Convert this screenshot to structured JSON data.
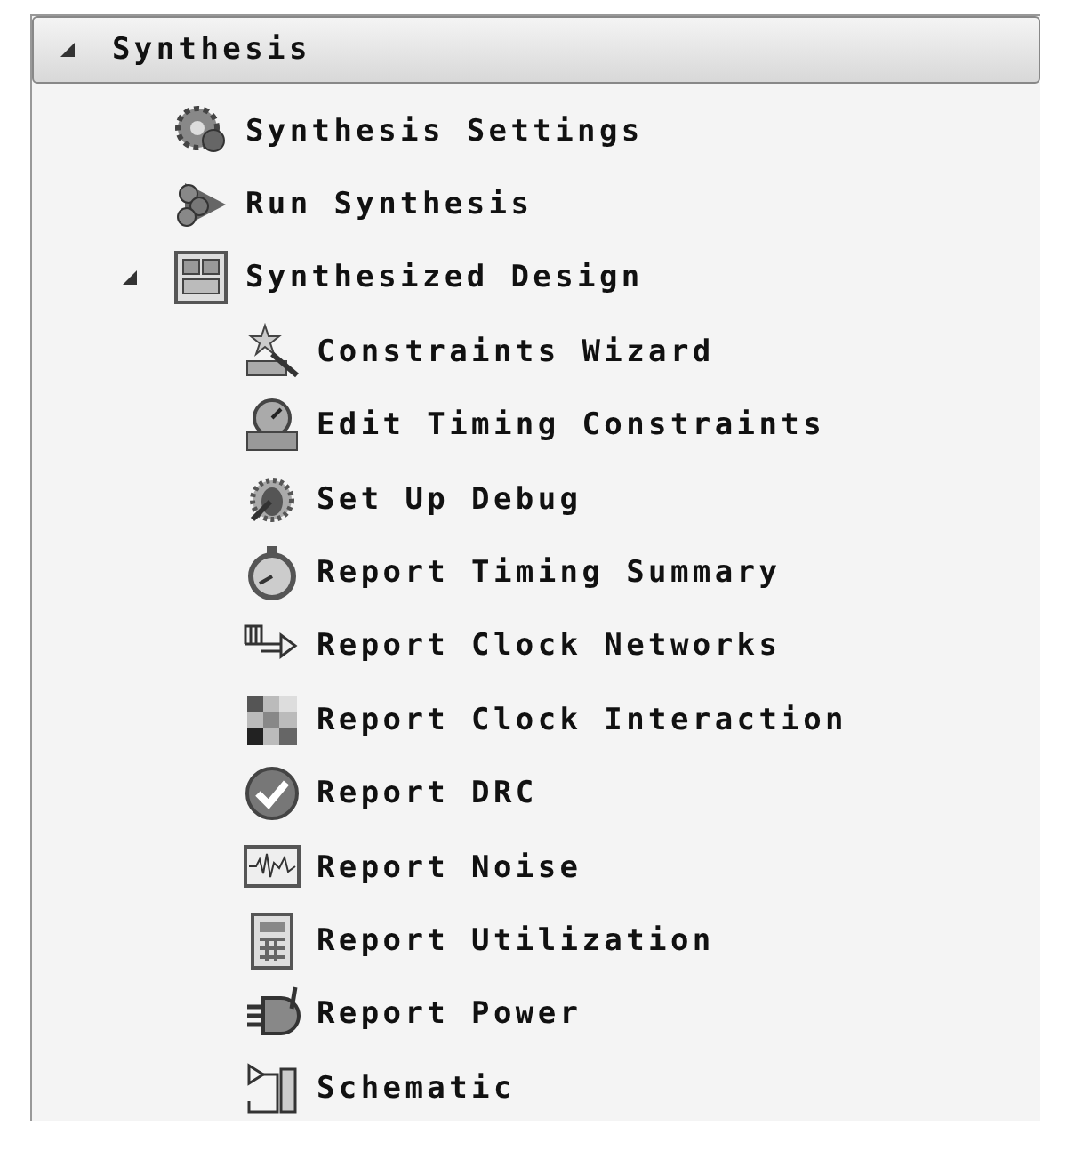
{
  "flow_navigator": {
    "section": {
      "label": "Synthesis",
      "expanded": true,
      "children": [
        {
          "label": "Synthesis Settings",
          "kind": "gear"
        },
        {
          "label": "Run Synthesis",
          "kind": "run"
        },
        {
          "label": "Synthesized Design",
          "kind": "design",
          "expanded": true,
          "children": [
            {
              "label": "Constraints Wizard",
              "kind": "wizard"
            },
            {
              "label": "Edit Timing Constraints",
              "kind": "timing-edit"
            },
            {
              "label": "Set Up Debug",
              "kind": "debug"
            },
            {
              "label": "Report Timing Summary",
              "kind": "stopwatch"
            },
            {
              "label": "Report Clock Networks",
              "kind": "clock-network"
            },
            {
              "label": "Report Clock Interaction",
              "kind": "matrix"
            },
            {
              "label": "Report DRC",
              "kind": "check"
            },
            {
              "label": "Report Noise",
              "kind": "noise"
            },
            {
              "label": "Report Utilization",
              "kind": "calculator"
            },
            {
              "label": "Report Power",
              "kind": "power"
            },
            {
              "label": "Schematic",
              "kind": "schematic"
            }
          ]
        }
      ]
    }
  }
}
